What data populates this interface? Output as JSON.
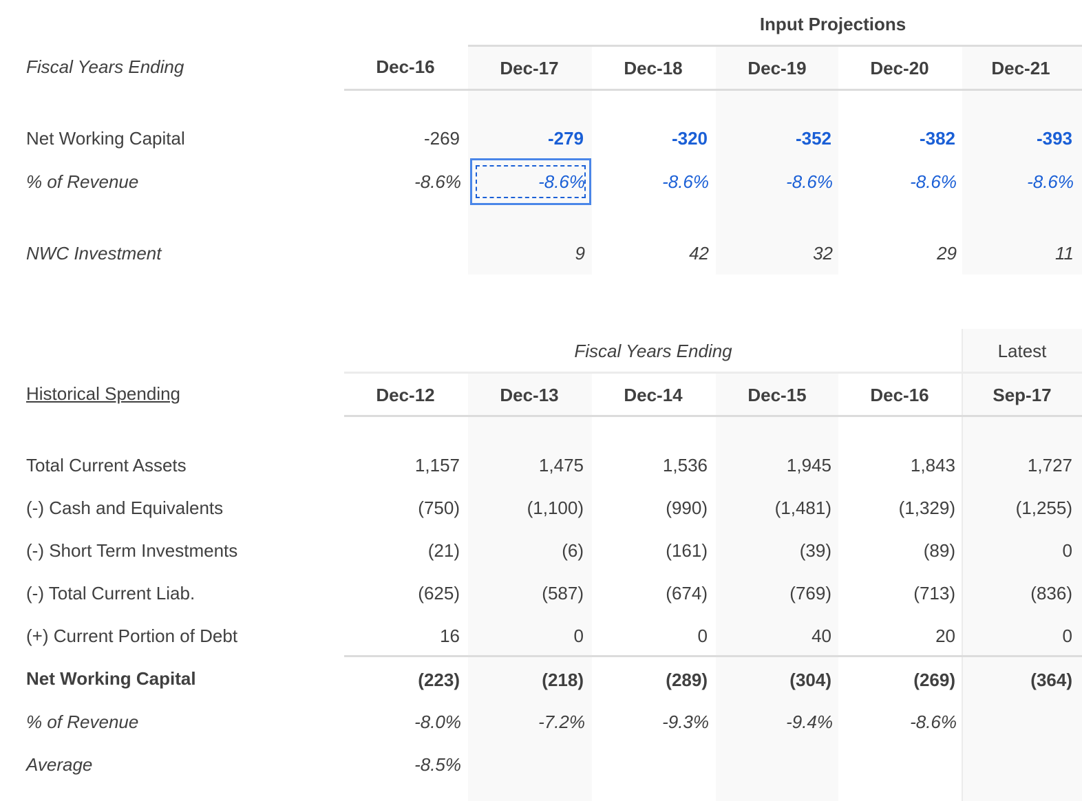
{
  "projections": {
    "section_title": "Input Projections",
    "row_header_label": "Fiscal Years Ending",
    "columns": [
      "Dec-16",
      "Dec-17",
      "Dec-18",
      "Dec-19",
      "Dec-20",
      "Dec-21"
    ],
    "rows": [
      {
        "label": "Net Working Capital",
        "style": "normal",
        "values": [
          "-269",
          "-279",
          "-320",
          "-352",
          "-382",
          "-393"
        ]
      },
      {
        "label": "% of Revenue",
        "style": "italic",
        "values": [
          "-8.6%",
          "-8.6%",
          "-8.6%",
          "-8.6%",
          "-8.6%",
          "-8.6%"
        ]
      },
      {
        "label": "NWC Investment",
        "style": "italic",
        "values": [
          "",
          "9",
          "42",
          "32",
          "29",
          "11"
        ]
      }
    ],
    "selected_cell": {
      "row": "% of Revenue",
      "column": "Dec-17",
      "value": "-8.6%"
    },
    "input_color": "#1a5fd6"
  },
  "historical": {
    "title": "Historical Spending",
    "group_header": "Fiscal Years Ending",
    "latest_header": "Latest",
    "columns": [
      "Dec-12",
      "Dec-13",
      "Dec-14",
      "Dec-15",
      "Dec-16",
      "Sep-17"
    ],
    "rows": [
      {
        "label": "Total Current Assets",
        "values": [
          "1,157",
          "1,475",
          "1,536",
          "1,945",
          "1,843",
          "1,727"
        ]
      },
      {
        "label": "(-) Cash and Equivalents",
        "values": [
          "(750)",
          "(1,100)",
          "(990)",
          "(1,481)",
          "(1,329)",
          "(1,255)"
        ]
      },
      {
        "label": "(-) Short Term Investments",
        "values": [
          "(21)",
          "(6)",
          "(161)",
          "(39)",
          "(89)",
          "0"
        ]
      },
      {
        "label": "(-) Total Current Liab.",
        "values": [
          "(625)",
          "(587)",
          "(674)",
          "(769)",
          "(713)",
          "(836)"
        ]
      },
      {
        "label": "(+) Current Portion of Debt",
        "values": [
          "16",
          "0",
          "0",
          "40",
          "20",
          "0"
        ]
      },
      {
        "label": "Net Working Capital",
        "values": [
          "(223)",
          "(218)",
          "(289)",
          "(304)",
          "(269)",
          "(364)"
        ]
      },
      {
        "label": "% of Revenue",
        "values": [
          "-8.0%",
          "-7.2%",
          "-9.3%",
          "-9.4%",
          "-8.6%",
          ""
        ]
      },
      {
        "label": "Average",
        "values": [
          "-8.5%",
          "",
          "",
          "",
          "",
          ""
        ]
      }
    ]
  }
}
